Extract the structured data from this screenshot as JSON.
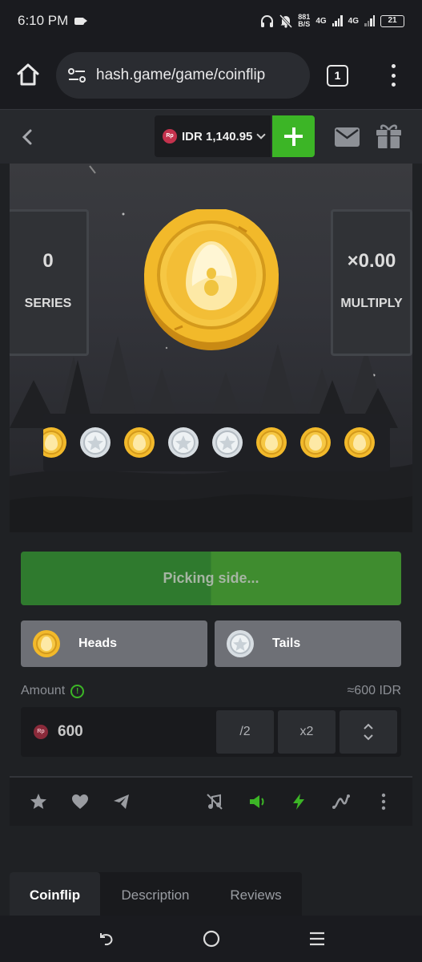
{
  "status_bar": {
    "time": "6:10 PM",
    "net_speed_value": "881",
    "net_speed_unit": "B/S",
    "net_type_1": "4G",
    "net_type_2": "4G",
    "battery": "21"
  },
  "browser": {
    "url": "hash.game/game/coinflip",
    "tab_count": "1"
  },
  "header": {
    "currency_badge": "Rp",
    "balance": "IDR 1,140.95"
  },
  "game": {
    "series_value": "0",
    "series_label": "SERIES",
    "multiply_value": "×0.00",
    "multiply_label": "MULTIPLY",
    "history": [
      "gold",
      "silver",
      "gold",
      "silver",
      "silver",
      "gold",
      "gold",
      "gold"
    ],
    "status_text": "Picking side..."
  },
  "controls": {
    "heads_label": "Heads",
    "tails_label": "Tails",
    "amount_label": "Amount",
    "amount_info": "!",
    "amount_converted": "≈600 IDR",
    "amount_badge": "Rp",
    "amount_value": "600",
    "half_label": "/2",
    "double_label": "x2"
  },
  "tabs": [
    {
      "label": "Coinflip",
      "active": true
    },
    {
      "label": "Description",
      "active": false
    },
    {
      "label": "Reviews",
      "active": false
    }
  ],
  "colors": {
    "accent_green": "#3cb526",
    "coin_gold": "#f2b92a",
    "coin_silver": "#d7dde2",
    "currency_red": "#c4324d"
  }
}
